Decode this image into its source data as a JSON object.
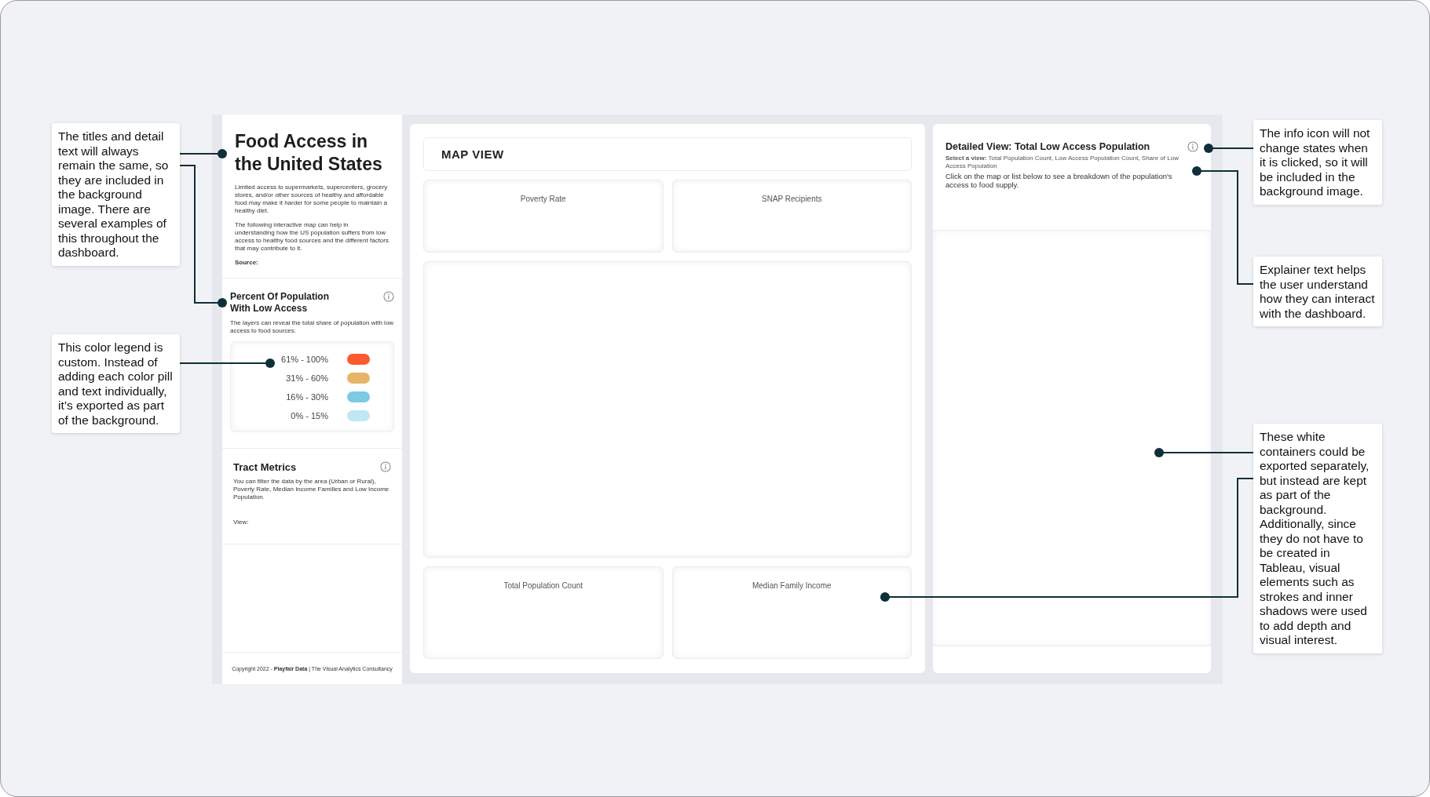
{
  "left_panel": {
    "intro": {
      "title": "Food Access in the United States",
      "paragraphs": [
        "Limited access to supermarkets, supercenters, grocery stores, and/or other sources of healthy and affordable food may make it harder for some people to maintain a healthy diet.",
        "The following interactive map can help in understanding how the US population suffers from low access to healthy food sources and the different factors that may contribute to it."
      ],
      "source_label": "Source:"
    },
    "legend_section": {
      "title": "Percent Of Population With Low Access",
      "description": "The layers can reveal the total share of population with low access to food sources.",
      "legend": [
        {
          "label": "61% - 100%",
          "color": "#fb5a2e"
        },
        {
          "label": "31% - 60%",
          "color": "#e7b46a"
        },
        {
          "label": "16% - 30%",
          "color": "#7ccbe3"
        },
        {
          "label": "0% - 15%",
          "color": "#bfe7f5"
        }
      ]
    },
    "tract_metrics": {
      "title": "Tract Metrics",
      "description": "You can filter the data by the area (Urban or Rural), Poverty Rate, Median Income Families and Low Income Population.",
      "view_label": "View:"
    },
    "footer": "Copyright 2022 - **Playfair Data** | The Visual Analytics Consultancy"
  },
  "map_panel": {
    "title": "MAP VIEW",
    "top_cards": [
      "Poverty Rate",
      "SNAP Recipients"
    ],
    "bottom_cards": [
      "Total Population Count",
      "Median Family Income"
    ]
  },
  "detail_panel": {
    "title": "Detailed View: Total Low Access Population",
    "view_hint": "**Select a view:** Total Population Count, Low Access Population Count, Share of Low Access Population",
    "explainer": "Click on the map or list below to see a breakdown of the population's access to food supply."
  },
  "annotations": [
    {
      "text": "The titles and detail text will always remain the same, so they are included in the background image. There are several examples of this throughout the dashboard."
    },
    {
      "text": "This color legend is custom. Instead of adding each color pill and text individually, it’s exported as part of the background."
    },
    {
      "text": "The info icon will not change states when it is clicked, so it will be included in the background image."
    },
    {
      "text": "Explainer text helps the user understand how they can interact with the dashboard."
    },
    {
      "text": "These white containers could be exported separately, but instead are kept as part of the background. Additionally, since they do not have to be created in Tableau, visual elements such as strokes and inner shadows were used to add depth and visual interest."
    }
  ]
}
